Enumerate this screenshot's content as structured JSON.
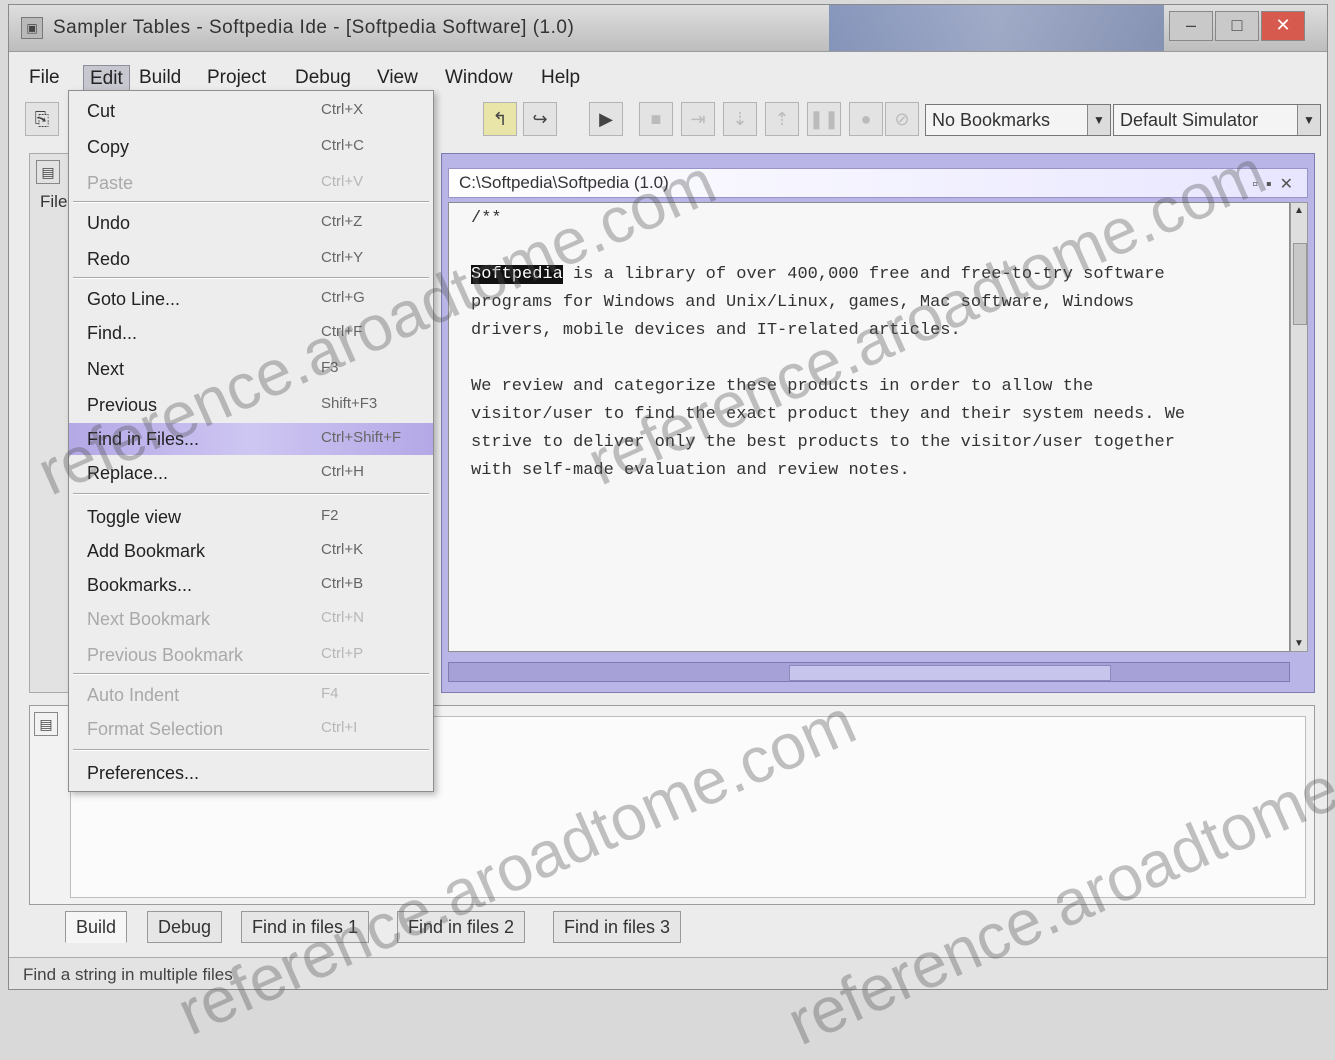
{
  "window": {
    "title": "Sampler Tables - Softpedia Ide - [Softpedia Software] (1.0)",
    "controls": [
      "–",
      "□",
      "✕"
    ]
  },
  "menubar": {
    "items": [
      "File",
      "Edit",
      "Build",
      "Project",
      "Debug",
      "View",
      "Window",
      "Help"
    ]
  },
  "toolbar": {
    "bookmarks_value": "No Bookmarks",
    "simulator_value": "Default Simulator"
  },
  "left_panel": {
    "label": "Files"
  },
  "edit_menu": {
    "items": [
      {
        "label": "Cut",
        "shortcut": "Ctrl+X"
      },
      {
        "label": "Copy",
        "shortcut": "Ctrl+C"
      },
      {
        "label": "Paste",
        "shortcut": "Ctrl+V"
      },
      {
        "label": "Undo",
        "shortcut": "Ctrl+Z"
      },
      {
        "label": "Redo",
        "shortcut": "Ctrl+Y"
      },
      {
        "label": "Goto Line...",
        "shortcut": "Ctrl+G"
      },
      {
        "label": "Find...",
        "shortcut": "Ctrl+F"
      },
      {
        "label": "Next",
        "shortcut": "F3"
      },
      {
        "label": "Previous",
        "shortcut": "Shift+F3"
      },
      {
        "label": "Find in Files...",
        "shortcut": "Ctrl+Shift+F"
      },
      {
        "label": "Replace...",
        "shortcut": "Ctrl+H"
      },
      {
        "label": "Toggle view",
        "shortcut": "F2"
      },
      {
        "label": "Add Bookmark",
        "shortcut": "Ctrl+K"
      },
      {
        "label": "Bookmarks...",
        "shortcut": "Ctrl+B"
      },
      {
        "label": "Next Bookmark",
        "shortcut": "Ctrl+N"
      },
      {
        "label": "Previous Bookmark",
        "shortcut": "Ctrl+P"
      },
      {
        "label": "Auto Indent",
        "shortcut": "F4"
      },
      {
        "label": "Format Selection",
        "shortcut": "Ctrl+I"
      },
      {
        "label": "Preferences...",
        "shortcut": ""
      }
    ]
  },
  "editor": {
    "tab_title": "C:\\Softpedia\\Softpedia (1.0)",
    "highlighted_word": "Softpedia",
    "lines": [
      "/**",
      " ",
      " is a library of over 400,000 free and free-to-try software",
      "programs for Windows and Unix/Linux, games, Mac software, Windows",
      "drivers, mobile devices and IT-related articles.",
      " ",
      "We review and categorize these products in order to allow the",
      "visitor/user to find the exact product they and their system needs. We",
      "strive to deliver only the best products to the visitor/user together",
      "with self-made evaluation and review notes."
    ]
  },
  "bottom_tabs": [
    "Build",
    "Debug",
    "Find in files 1",
    "Find in files 2",
    "Find in files 3"
  ],
  "status": {
    "text": "Find a string in multiple files"
  },
  "watermark": "reference.aroadtome.com",
  "colors": {
    "selection": "#b4a8e6",
    "editor_frame": "#b9b5e6"
  }
}
